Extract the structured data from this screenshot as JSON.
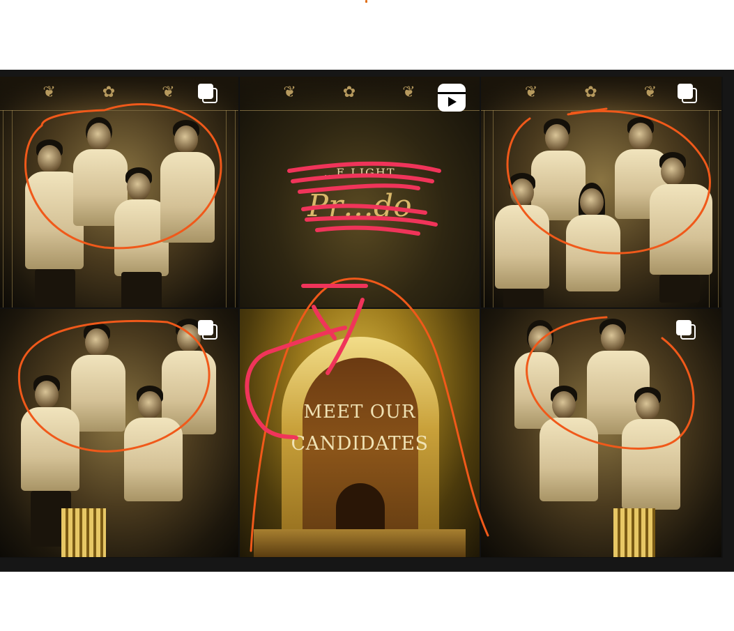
{
  "center_top": {
    "heading_line1": "…E LIGHT",
    "heading_line2": "Pr…do"
  },
  "center_bottom": {
    "line1": "MEET OUR",
    "line2": "CANDIDATES"
  },
  "icons": {
    "tile1": "multiple-posts-icon",
    "tile2": "reels-icon",
    "tile3": "multiple-posts-icon",
    "tile4": "multiple-posts-icon",
    "tile6": "multiple-posts-icon"
  },
  "colors": {
    "annotation_orange": "#f0591a",
    "annotation_pink": "#f0345a",
    "gold": "#d9b844"
  }
}
